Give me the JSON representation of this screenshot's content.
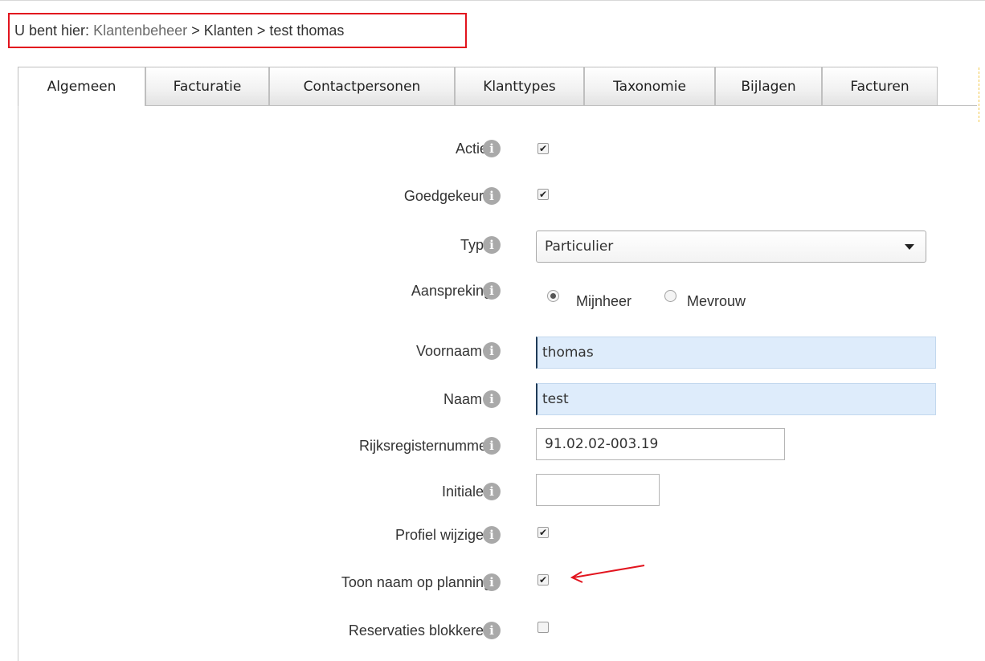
{
  "breadcrumb": {
    "prefix": "U bent hier:",
    "link": "Klantenbeheer",
    "sep1": ">",
    "item2": "Klanten",
    "sep2": ">",
    "current": "test thomas"
  },
  "tabs": [
    "Algemeen",
    "Facturatie",
    "Contactpersonen",
    "Klanttypes",
    "Taxonomie",
    "Bijlagen",
    "Facturen"
  ],
  "active_tab": "Algemeen",
  "info_icon_glyph": "i",
  "check_glyph": "✔",
  "form": {
    "actief": {
      "label": "Actief",
      "checked": true
    },
    "goedgekeurd": {
      "label": "Goedgekeurd",
      "checked": true
    },
    "type": {
      "label": "Type",
      "value": "Particulier"
    },
    "aanspreking": {
      "label": "Aanspreking",
      "option1": "Mijnheer",
      "option2": "Mevrouw",
      "selected": "Mijnheer"
    },
    "voornaam": {
      "label": "Voornaam *",
      "value": "thomas"
    },
    "naam": {
      "label": "Naam *",
      "value": "test"
    },
    "rijksregisternummer": {
      "label": "Rijksregisternummer",
      "value": "91.02.02-003.19"
    },
    "initialen": {
      "label": "Initialen",
      "value": ""
    },
    "profiel_wijzigen": {
      "label": "Profiel wijzigen",
      "checked": true
    },
    "toon_naam": {
      "label": "Toon naam op planning",
      "checked": true
    },
    "reservaties_blokkeren": {
      "label": "Reservaties blokkeren",
      "checked": false
    }
  },
  "colors": {
    "highlight_box": "#e2141e",
    "annotation_arrow": "#e2141e",
    "filled_input_bg": "#deecfb"
  },
  "icons": {
    "info": "info-circle-icon",
    "annotation": "red-arrow-annotation"
  }
}
